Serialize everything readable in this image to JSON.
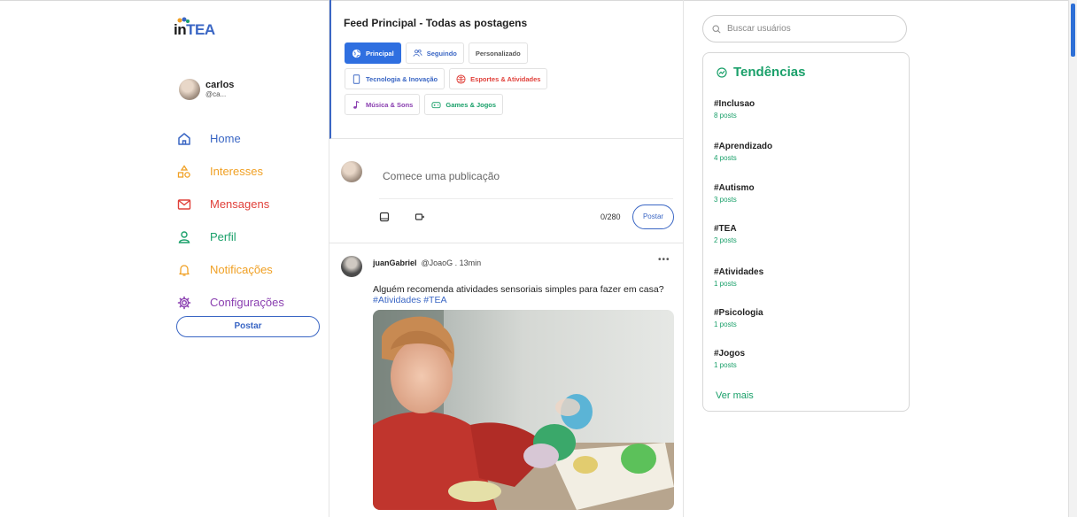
{
  "app": {
    "logo_text_in": "in",
    "logo_text_tea": "TEA"
  },
  "user": {
    "name": "carlos",
    "handle": "@ca..."
  },
  "nav": [
    {
      "label": "Home",
      "icon": "home-icon",
      "color": "#3a66c4"
    },
    {
      "label": "Interesses",
      "icon": "shapes-icon",
      "color": "#f0a024"
    },
    {
      "label": "Mensagens",
      "icon": "mail-icon",
      "color": "#e0403a"
    },
    {
      "label": "Perfil",
      "icon": "user-icon",
      "color": "#1aa06a"
    },
    {
      "label": "Notificações",
      "icon": "bell-icon",
      "color": "#f0a024"
    },
    {
      "label": "Configurações",
      "icon": "gear-icon",
      "color": "#8a3fb0"
    }
  ],
  "sidebar_post_label": "Postar",
  "feed": {
    "title": "Feed Principal - Todas as postagens",
    "chips": [
      [
        {
          "label": "Principal",
          "icon": "globe-icon",
          "color": "#ffffff",
          "active": true
        },
        {
          "label": "Seguindo",
          "icon": "users-icon",
          "color": "#3a66c4",
          "active": false
        },
        {
          "label": "Personalizado",
          "icon": "",
          "color": "#555555",
          "active": false
        }
      ],
      [
        {
          "label": "Tecnologia & Inovação",
          "icon": "tablet-icon",
          "color": "#3a66c4",
          "active": false
        },
        {
          "label": "Esportes & Atividades",
          "icon": "ball-icon",
          "color": "#e0403a",
          "active": false
        }
      ],
      [
        {
          "label": "Música & Sons",
          "icon": "music-icon",
          "color": "#8a3fb0",
          "active": false
        },
        {
          "label": "Games & Jogos",
          "icon": "gamepad-icon",
          "color": "#1aa06a",
          "active": false
        }
      ]
    ]
  },
  "composer": {
    "placeholder": "Comece uma publicação",
    "count": "0/280",
    "post_label": "Postar"
  },
  "post": {
    "author": "juanGabriel",
    "handle_time": "@JoaoG . 13min",
    "more": "•••",
    "text": "Alguém recomenda atividades sensoriais simples para fazer em casa?",
    "tags": "#Atividades #TEA"
  },
  "search": {
    "placeholder": "Buscar usuários"
  },
  "trends": {
    "title": "Tendências",
    "items": [
      {
        "tag": "#Inclusao",
        "count": "8 posts"
      },
      {
        "tag": "#Aprendizado",
        "count": "4 posts"
      },
      {
        "tag": "#Autismo",
        "count": "3 posts"
      },
      {
        "tag": "#TEA",
        "count": "2 posts"
      },
      {
        "tag": "#Atividades",
        "count": "1 posts"
      },
      {
        "tag": "#Psicologia",
        "count": "1 posts"
      },
      {
        "tag": "#Jogos",
        "count": "1 posts"
      }
    ],
    "more_label": "Ver mais"
  }
}
